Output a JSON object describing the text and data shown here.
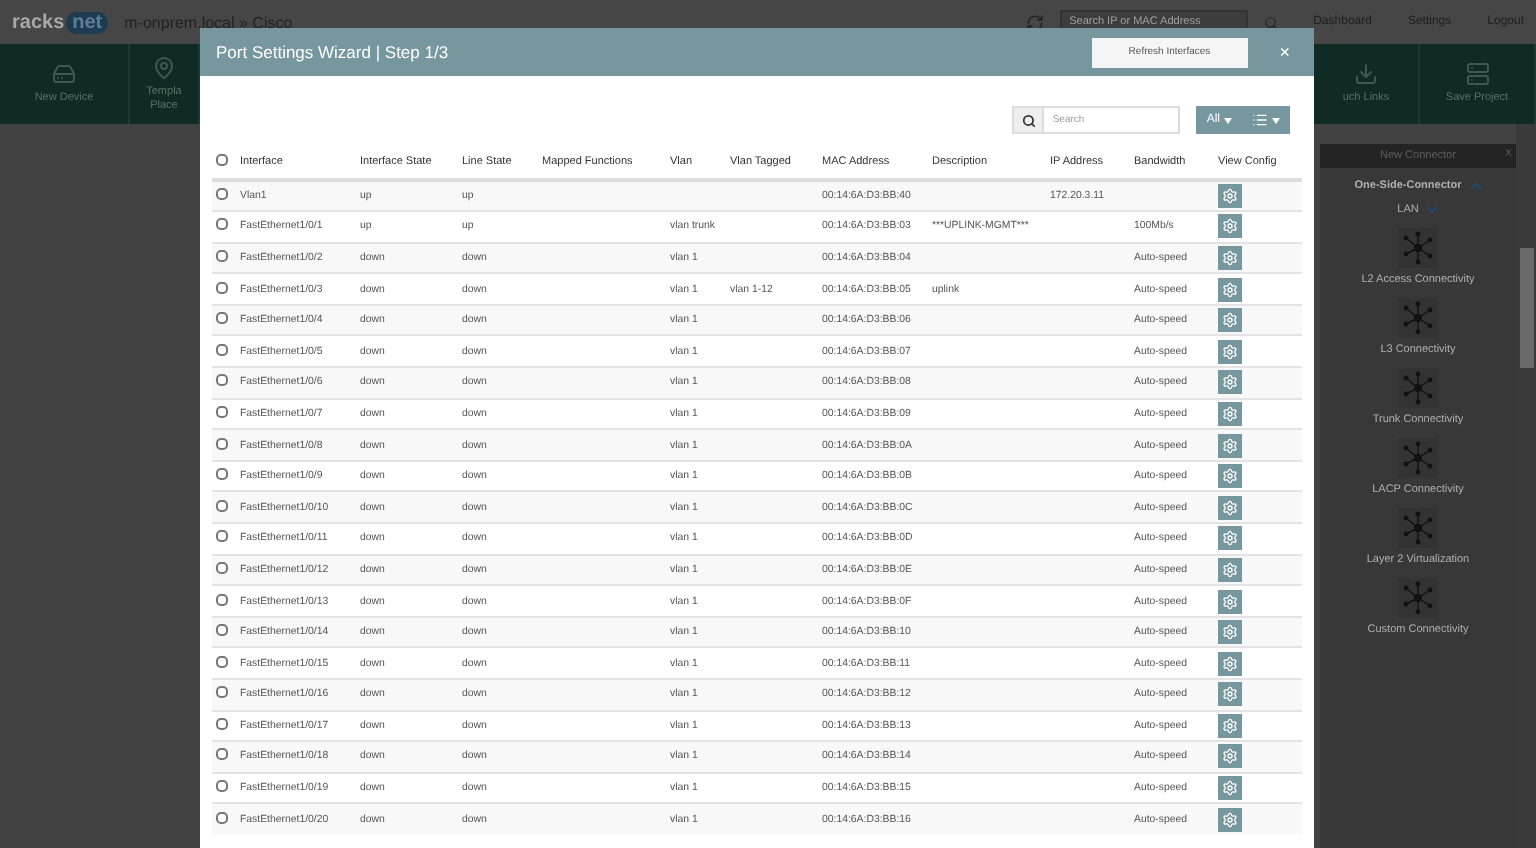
{
  "app_header": {
    "logo_left": "racks",
    "logo_right": "net",
    "breadcrumb": "m-onprem.local » Cisco",
    "search": {
      "placeholder": "Search IP or MAC Address"
    },
    "links": [
      "Dashboard",
      "Settings",
      "Logout"
    ]
  },
  "toolbar": {
    "items": [
      {
        "kind": "device",
        "lines": [
          "New Device"
        ]
      },
      {
        "kind": "template",
        "lines": [
          "Templa",
          "Place"
        ]
      },
      {
        "kind": "links",
        "lines": [
          "uch Links"
        ]
      },
      {
        "kind": "save",
        "lines": [
          "Save Project"
        ]
      }
    ]
  },
  "connector_panel": {
    "title": "New Connector",
    "close": "X",
    "section": {
      "label": "One-Side-Connector",
      "expanded": true
    },
    "group": {
      "label": "LAN",
      "expanded": false
    },
    "items": [
      "L2 Access Connectivity",
      "L3 Connectivity",
      "Trunk Connectivity",
      "LACP Connectivity",
      "Layer 2 Virtualization",
      "Custom Connectivity"
    ]
  },
  "modal": {
    "title": "Port Settings Wizard | Step 1/3",
    "refresh_button": "Refresh Interfaces",
    "close": "×",
    "search": {
      "placeholder": "Search"
    },
    "filter_button": "All",
    "select_all": {
      "checked": false
    },
    "columns": [
      "Interface",
      "Interface State",
      "Line State",
      "Mapped Functions",
      "Vlan",
      "Vlan Tagged",
      "MAC Address",
      "Description",
      "IP Address",
      "Bandwidth",
      "View Config"
    ],
    "rows": [
      {
        "checked": false,
        "cells": [
          "Vlan1",
          "up",
          "up",
          "",
          "",
          "",
          "00:14:6A:D3:BB:40",
          "",
          "172.20.3.11",
          ""
        ]
      },
      {
        "checked": false,
        "cells": [
          "FastEthernet1/0/1",
          "up",
          "up",
          "",
          "vlan trunk",
          "",
          "00:14:6A:D3:BB:03",
          "***UPLINK-MGMT***",
          "",
          "100Mb/s"
        ]
      },
      {
        "checked": false,
        "cells": [
          "FastEthernet1/0/2",
          "down",
          "down",
          "",
          "vlan 1",
          "",
          "00:14:6A:D3:BB:04",
          "",
          "",
          "Auto-speed"
        ]
      },
      {
        "checked": false,
        "cells": [
          "FastEthernet1/0/3",
          "down",
          "down",
          "",
          "vlan 1",
          "vlan 1-12",
          "00:14:6A:D3:BB:05",
          "uplink",
          "",
          "Auto-speed"
        ]
      },
      {
        "checked": false,
        "cells": [
          "FastEthernet1/0/4",
          "down",
          "down",
          "",
          "vlan 1",
          "",
          "00:14:6A:D3:BB:06",
          "",
          "",
          "Auto-speed"
        ]
      },
      {
        "checked": false,
        "cells": [
          "FastEthernet1/0/5",
          "down",
          "down",
          "",
          "vlan 1",
          "",
          "00:14:6A:D3:BB:07",
          "",
          "",
          "Auto-speed"
        ]
      },
      {
        "checked": false,
        "cells": [
          "FastEthernet1/0/6",
          "down",
          "down",
          "",
          "vlan 1",
          "",
          "00:14:6A:D3:BB:08",
          "",
          "",
          "Auto-speed"
        ]
      },
      {
        "checked": false,
        "cells": [
          "FastEthernet1/0/7",
          "down",
          "down",
          "",
          "vlan 1",
          "",
          "00:14:6A:D3:BB:09",
          "",
          "",
          "Auto-speed"
        ]
      },
      {
        "checked": false,
        "cells": [
          "FastEthernet1/0/8",
          "down",
          "down",
          "",
          "vlan 1",
          "",
          "00:14:6A:D3:BB:0A",
          "",
          "",
          "Auto-speed"
        ]
      },
      {
        "checked": false,
        "cells": [
          "FastEthernet1/0/9",
          "down",
          "down",
          "",
          "vlan 1",
          "",
          "00:14:6A:D3:BB:0B",
          "",
          "",
          "Auto-speed"
        ]
      },
      {
        "checked": false,
        "cells": [
          "FastEthernet1/0/10",
          "down",
          "down",
          "",
          "vlan 1",
          "",
          "00:14:6A:D3:BB:0C",
          "",
          "",
          "Auto-speed"
        ]
      },
      {
        "checked": false,
        "cells": [
          "FastEthernet1/0/11",
          "down",
          "down",
          "",
          "vlan 1",
          "",
          "00:14:6A:D3:BB:0D",
          "",
          "",
          "Auto-speed"
        ]
      },
      {
        "checked": false,
        "cells": [
          "FastEthernet1/0/12",
          "down",
          "down",
          "",
          "vlan 1",
          "",
          "00:14:6A:D3:BB:0E",
          "",
          "",
          "Auto-speed"
        ]
      },
      {
        "checked": false,
        "cells": [
          "FastEthernet1/0/13",
          "down",
          "down",
          "",
          "vlan 1",
          "",
          "00:14:6A:D3:BB:0F",
          "",
          "",
          "Auto-speed"
        ]
      },
      {
        "checked": false,
        "cells": [
          "FastEthernet1/0/14",
          "down",
          "down",
          "",
          "vlan 1",
          "",
          "00:14:6A:D3:BB:10",
          "",
          "",
          "Auto-speed"
        ]
      },
      {
        "checked": false,
        "cells": [
          "FastEthernet1/0/15",
          "down",
          "down",
          "",
          "vlan 1",
          "",
          "00:14:6A:D3:BB:11",
          "",
          "",
          "Auto-speed"
        ]
      },
      {
        "checked": false,
        "cells": [
          "FastEthernet1/0/16",
          "down",
          "down",
          "",
          "vlan 1",
          "",
          "00:14:6A:D3:BB:12",
          "",
          "",
          "Auto-speed"
        ]
      },
      {
        "checked": false,
        "cells": [
          "FastEthernet1/0/17",
          "down",
          "down",
          "",
          "vlan 1",
          "",
          "00:14:6A:D3:BB:13",
          "",
          "",
          "Auto-speed"
        ]
      },
      {
        "checked": false,
        "cells": [
          "FastEthernet1/0/18",
          "down",
          "down",
          "",
          "vlan 1",
          "",
          "00:14:6A:D3:BB:14",
          "",
          "",
          "Auto-speed"
        ]
      },
      {
        "checked": false,
        "cells": [
          "FastEthernet1/0/19",
          "down",
          "down",
          "",
          "vlan 1",
          "",
          "00:14:6A:D3:BB:15",
          "",
          "",
          "Auto-speed"
        ]
      },
      {
        "checked": false,
        "cells": [
          "FastEthernet1/0/20",
          "down",
          "down",
          "",
          "vlan 1",
          "",
          "00:14:6A:D3:BB:16",
          "",
          "",
          "Auto-speed"
        ]
      }
    ]
  }
}
